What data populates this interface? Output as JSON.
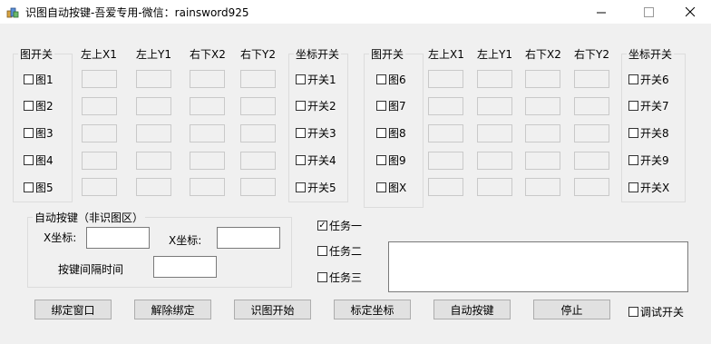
{
  "window": {
    "title": "识图自动按键-吾爱专用-微信：rainsword925",
    "minimize_glyph": "—",
    "maximize_glyph": "☐",
    "close_glyph": "✕"
  },
  "left_panel": {
    "col_headers": [
      "图开关",
      "左上X1",
      "左上Y1",
      "右下X2",
      "右下Y2",
      "坐标开关"
    ],
    "images": [
      "图1",
      "图2",
      "图3",
      "图4",
      "图5"
    ],
    "switches": [
      "开关1",
      "开关2",
      "开关3",
      "开关4",
      "开关5"
    ]
  },
  "right_panel": {
    "col_headers": [
      "图开关",
      "左上X1",
      "左上Y1",
      "右下X2",
      "右下Y2",
      "坐标开关"
    ],
    "images": [
      "图6",
      "图7",
      "图8",
      "图9",
      "图X"
    ],
    "switches": [
      "开关6",
      "开关7",
      "开关8",
      "开关9",
      "开关X"
    ]
  },
  "auto_key": {
    "group_label": "自动按键（非识图区）",
    "x_label": "X坐标:",
    "y_label": "X坐标:",
    "interval_label": "按键间隔时间",
    "x_value": "",
    "y_value": "",
    "interval_value": ""
  },
  "tasks": [
    {
      "label": "任务一",
      "checked": true
    },
    {
      "label": "任务二",
      "checked": false
    },
    {
      "label": "任务三",
      "checked": false
    }
  ],
  "log_text": "",
  "buttons": [
    "绑定窗口",
    "解除绑定",
    "识图开始",
    "标定坐标",
    "自动按键",
    "停止"
  ],
  "debug_switch": {
    "label": "调试开关",
    "checked": false
  },
  "check_glyph": "✓"
}
